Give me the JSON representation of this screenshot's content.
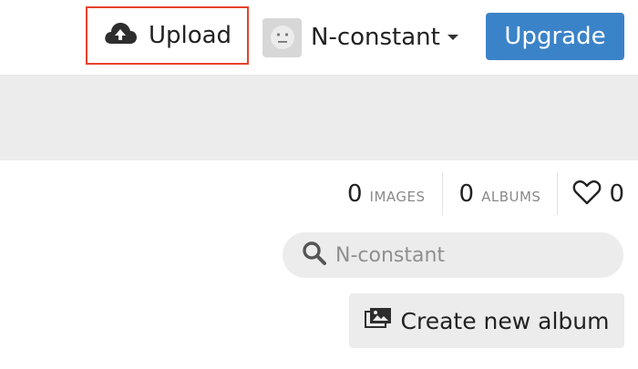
{
  "header": {
    "upload_label": "Upload",
    "user_name": "N-constant",
    "upgrade_label": "Upgrade"
  },
  "stats": {
    "images_count": "0",
    "images_label": "IMAGES",
    "albums_count": "0",
    "albums_label": "ALBUMS",
    "likes_count": "0"
  },
  "search": {
    "placeholder": "N-constant"
  },
  "actions": {
    "create_album_label": "Create new album"
  },
  "icons": {
    "upload": "cloud-upload-icon",
    "avatar": "face-avatar-icon",
    "caret": "caret-down-icon",
    "likes": "heart-icon",
    "search": "search-icon",
    "album": "images-icon"
  },
  "colors": {
    "upgrade_bg": "#3b83c8",
    "highlight_border": "#e8412c",
    "gray_band": "#ececec"
  }
}
